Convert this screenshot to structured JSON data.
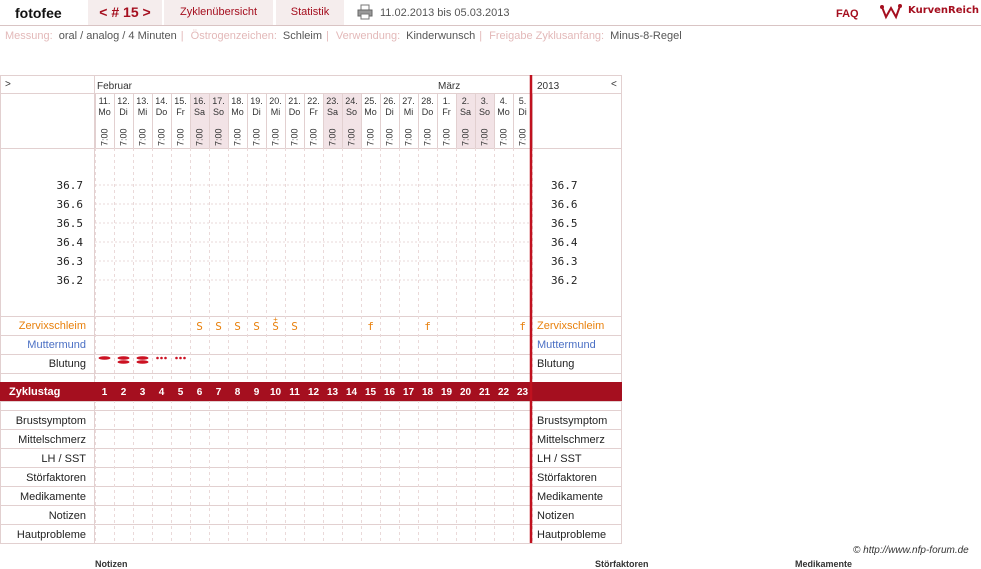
{
  "topbar": {
    "username": "fotofee",
    "cycle_label": "< # 15 >",
    "overview_label": "Zyklenübersicht",
    "stats_label": "Statistik",
    "date_range": "11.02.2013 bis 05.03.2013",
    "faq_label": "FAQ",
    "logo_text": "KurvenReich"
  },
  "settings": [
    {
      "key": "Messung:",
      "value": "oral / analog / 4 Minuten"
    },
    {
      "key": "Östrogenzeichen:",
      "value": "Schleim"
    },
    {
      "key": "Verwendung:",
      "value": "Kinderwunsch"
    },
    {
      "key": "Freigabe Zyklusanfang:",
      "value": "Minus-8-Regel"
    }
  ],
  "chart": {
    "nav_left": ">",
    "nav_right": "<",
    "month_labels": [
      "Februar",
      "März"
    ],
    "year": "2013",
    "time_label": "7:00",
    "days": [
      {
        "date": "11.",
        "wd": "Mo",
        "cycle": "1",
        "weekend": false,
        "zs": "",
        "bleed": "heavy"
      },
      {
        "date": "12.",
        "wd": "Di",
        "cycle": "2",
        "weekend": false,
        "zs": "",
        "bleed": "heavy"
      },
      {
        "date": "13.",
        "wd": "Mi",
        "cycle": "3",
        "weekend": false,
        "zs": "",
        "bleed": "heavy"
      },
      {
        "date": "14.",
        "wd": "Do",
        "cycle": "4",
        "weekend": false,
        "zs": "",
        "bleed": "spot"
      },
      {
        "date": "15.",
        "wd": "Fr",
        "cycle": "5",
        "weekend": false,
        "zs": "",
        "bleed": "spot"
      },
      {
        "date": "16.",
        "wd": "Sa",
        "cycle": "6",
        "weekend": true,
        "zs": "S",
        "bleed": ""
      },
      {
        "date": "17.",
        "wd": "So",
        "cycle": "7",
        "weekend": true,
        "zs": "S",
        "bleed": ""
      },
      {
        "date": "18.",
        "wd": "Mo",
        "cycle": "8",
        "weekend": false,
        "zs": "S",
        "bleed": ""
      },
      {
        "date": "19.",
        "wd": "Di",
        "cycle": "9",
        "weekend": false,
        "zs": "S",
        "bleed": ""
      },
      {
        "date": "20.",
        "wd": "Mi",
        "cycle": "10",
        "weekend": false,
        "zs": "S+",
        "bleed": ""
      },
      {
        "date": "21.",
        "wd": "Do",
        "cycle": "11",
        "weekend": false,
        "zs": "S",
        "bleed": ""
      },
      {
        "date": "22.",
        "wd": "Fr",
        "cycle": "12",
        "weekend": false,
        "zs": "",
        "bleed": ""
      },
      {
        "date": "23.",
        "wd": "Sa",
        "cycle": "13",
        "weekend": true,
        "zs": "",
        "bleed": ""
      },
      {
        "date": "24.",
        "wd": "So",
        "cycle": "14",
        "weekend": true,
        "zs": "",
        "bleed": ""
      },
      {
        "date": "25.",
        "wd": "Mo",
        "cycle": "15",
        "weekend": false,
        "zs": "f",
        "bleed": ""
      },
      {
        "date": "26.",
        "wd": "Di",
        "cycle": "16",
        "weekend": false,
        "zs": "",
        "bleed": ""
      },
      {
        "date": "27.",
        "wd": "Mi",
        "cycle": "17",
        "weekend": false,
        "zs": "",
        "bleed": ""
      },
      {
        "date": "28.",
        "wd": "Do",
        "cycle": "18",
        "weekend": false,
        "zs": "f",
        "bleed": ""
      },
      {
        "date": "1.",
        "wd": "Fr",
        "cycle": "19",
        "weekend": false,
        "zs": "",
        "bleed": ""
      },
      {
        "date": "2.",
        "wd": "Sa",
        "cycle": "20",
        "weekend": true,
        "zs": "",
        "bleed": ""
      },
      {
        "date": "3.",
        "wd": "So",
        "cycle": "21",
        "weekend": true,
        "zs": "",
        "bleed": ""
      },
      {
        "date": "4.",
        "wd": "Mo",
        "cycle": "22",
        "weekend": false,
        "zs": "",
        "bleed": ""
      },
      {
        "date": "5.",
        "wd": "Di",
        "cycle": "23",
        "weekend": false,
        "zs": "f",
        "bleed": ""
      }
    ],
    "temps": [
      "36.7",
      "36.6",
      "36.5",
      "36.4",
      "36.3",
      "36.2"
    ],
    "rows": {
      "cervix_mucus": "Zervixschleim",
      "cervix": "Muttermund",
      "bleeding": "Blutung",
      "cycle_day": "Zyklustag",
      "breast": "Brustsymptom",
      "mittelschmerz": "Mittelschmerz",
      "lh": "LH / SST",
      "disturb": "Störfaktoren",
      "meds": "Medikamente",
      "notes": "Notizen",
      "skin": "Hautprobleme"
    },
    "colors": {
      "accent": "#a50f1f",
      "mucus": "#e8800c",
      "cervix": "#4a6fc4",
      "weekend": "#f2e3e6",
      "grid": "#e2d0d0"
    }
  },
  "footer": {
    "copyright": "© http://www.nfp-forum.de",
    "col_notes": "Notizen",
    "col_disturb": "Störfaktoren",
    "col_meds": "Medikamente"
  }
}
